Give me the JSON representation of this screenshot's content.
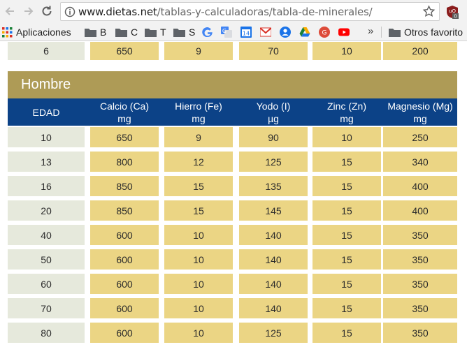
{
  "browser": {
    "url_host": "www.dietas.net",
    "url_path": "/tablas-y-calculadoras/tabla-de-minerales/",
    "extension_badge": "0"
  },
  "bookmarks": {
    "apps_label": "Aplicaciones",
    "folders": [
      "B",
      "C",
      "T",
      "S"
    ],
    "calendar_day": "14",
    "overflow": "»",
    "other_label": "Otros favorito"
  },
  "table": {
    "section_title": "Hombre",
    "headers": [
      {
        "name": "EDAD",
        "unit": ""
      },
      {
        "name": "Calcio (Ca)",
        "unit": "mg"
      },
      {
        "name": "Hierro (Fe)",
        "unit": "mg"
      },
      {
        "name": "Yodo (I)",
        "unit": "µg"
      },
      {
        "name": "Zinc (Zn)",
        "unit": "mg"
      },
      {
        "name": "Magnesio (Mg)",
        "unit": "mg"
      }
    ],
    "previous_row": [
      "6",
      "650",
      "9",
      "70",
      "10",
      "200"
    ],
    "rows": [
      [
        "10",
        "650",
        "9",
        "90",
        "10",
        "250"
      ],
      [
        "13",
        "800",
        "12",
        "125",
        "15",
        "340"
      ],
      [
        "16",
        "850",
        "15",
        "135",
        "15",
        "400"
      ],
      [
        "20",
        "850",
        "15",
        "145",
        "15",
        "400"
      ],
      [
        "40",
        "600",
        "10",
        "140",
        "15",
        "350"
      ],
      [
        "50",
        "600",
        "10",
        "140",
        "15",
        "350"
      ],
      [
        "60",
        "600",
        "10",
        "140",
        "15",
        "350"
      ],
      [
        "70",
        "600",
        "10",
        "140",
        "15",
        "350"
      ],
      [
        "80",
        "600",
        "10",
        "125",
        "15",
        "350"
      ]
    ]
  }
}
